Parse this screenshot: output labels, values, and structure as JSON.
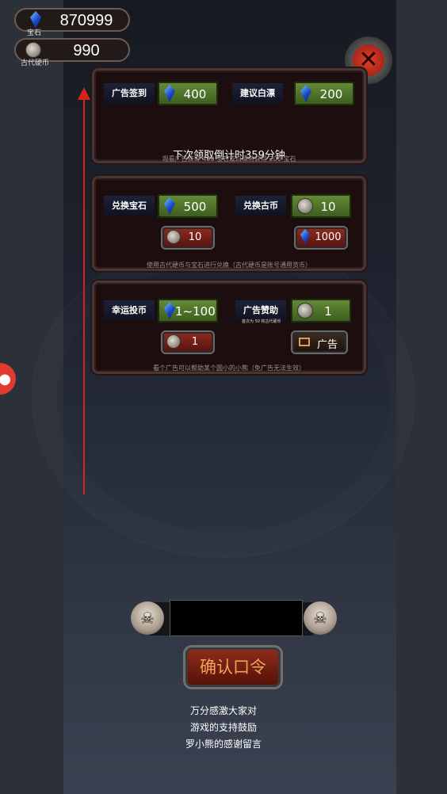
{
  "currency": {
    "gems": {
      "value": "870999",
      "caption": "宝石"
    },
    "coins": {
      "value": "990",
      "caption": "古代硬币"
    }
  },
  "panels": {
    "sign_in": {
      "ad_sign_label": "广告签到",
      "ad_sign_value": "400",
      "suggest_label": "建议白漂",
      "suggest_value": "200",
      "countdown": "下次领取倒计时359分钟",
      "footnote": "观看广告获得 400 宝石或白漂将获得 200 宝石"
    },
    "exchange": {
      "gem_label": "兑换宝石",
      "gem_value": "500",
      "gem_cost": "10",
      "coin_label": "兑换古币",
      "coin_value": "10",
      "coin_cost": "1000",
      "footnote": "使用古代硬币与宝石进行兑换（古代硬币是账号通用货币）"
    },
    "lucky": {
      "lucky_label": "幸运投币",
      "lucky_value": "1~100",
      "lucky_cost": "1",
      "sponsor_label": "广告赞助",
      "sponsor_note": "首次为 50 枚古代硬币",
      "sponsor_value": "1",
      "ad_button": "广告",
      "footnote": "看个广告可以帮助某个圆小的小熊（免广告无法生效）"
    }
  },
  "code_entry": {
    "input_value": "",
    "confirm_label": "确认口令"
  },
  "thanks": {
    "line1": "万分感激大家对",
    "line2": "游戏的支持鼓励",
    "line3": "罗小熊的感谢留言"
  },
  "colors": {
    "accent_red": "#d8231c",
    "button_green": "#628a36",
    "confirm_text": "#f0a45a"
  }
}
